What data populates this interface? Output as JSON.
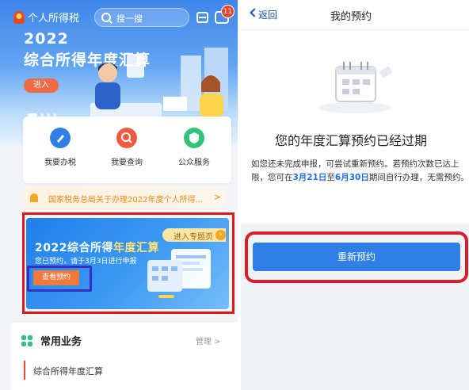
{
  "left": {
    "app_title": "个人所得税",
    "search_placeholder": "搜一搜",
    "message_count": "11",
    "banner": {
      "year": "2022",
      "title": "综合所得年度汇算",
      "enter_label": "进入"
    },
    "quick_actions": [
      {
        "label": "我要办税",
        "color": "#2f7fe6"
      },
      {
        "label": "我要查询",
        "color": "#f05a40"
      },
      {
        "label": "公众服务",
        "color": "#35c27a"
      }
    ],
    "notice": {
      "text": "国家税务总局关于办理2022年度个人所得...",
      "arrow": ">"
    },
    "promo": {
      "tag": "进入专题页",
      "tag_icon": "›",
      "title_part1": "2022综合所得",
      "title_part2": "年度汇算",
      "subtitle": "您已预约，请于3月3日进行申报",
      "view_button": "查看预约"
    },
    "common": {
      "title": "常用业务",
      "manage": "管理 >",
      "items": [
        {
          "label": "综合所得年度汇算"
        }
      ]
    }
  },
  "right": {
    "back_label": "返回",
    "nav_title": "我的预约",
    "status_title": "您的年度汇算预约已经过期",
    "desc_part1": "如您还未完成申报，可尝试重新预约。若预约次数已达上限，您可在",
    "desc_date1": "3月21日",
    "desc_part2": "至",
    "desc_date2": "6月30日",
    "desc_part3": "期间自行办理，无需预约。",
    "rebook_button": "重新预约"
  },
  "colors": {
    "brand_blue": "#2f7fe6",
    "highlight_red": "#d8202a",
    "accent_orange": "#f07a3a",
    "notice_orange": "#e98a15"
  }
}
